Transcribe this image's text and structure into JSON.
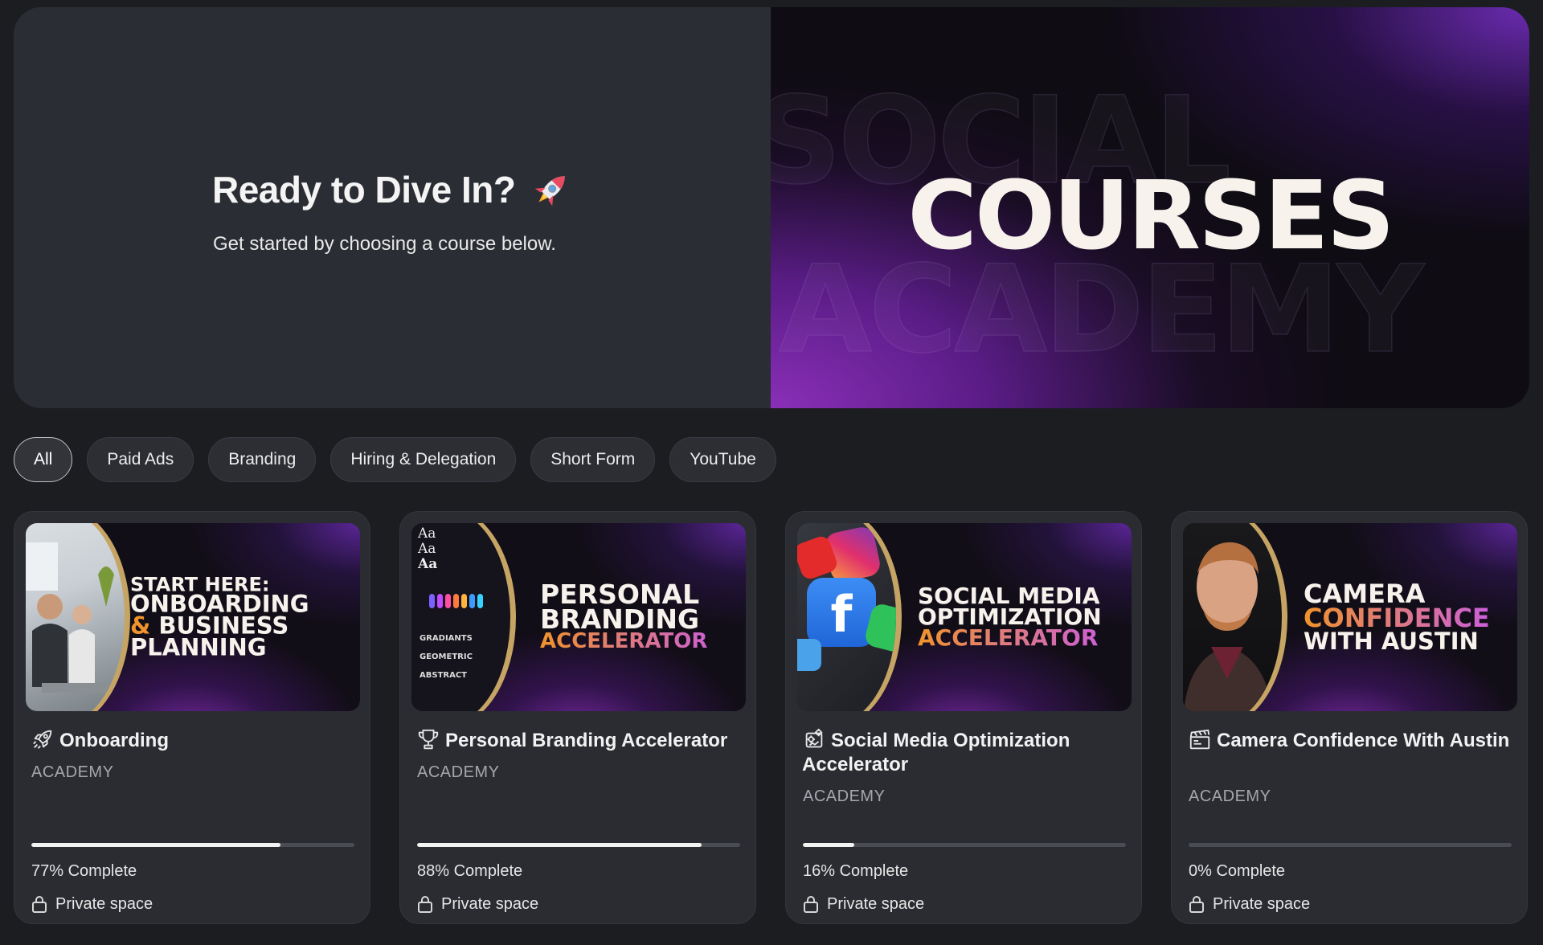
{
  "hero": {
    "heading": "Ready to Dive In?",
    "subheading": "Get started by choosing a course below.",
    "banner_title": "COURSES",
    "banner_ghost_1": "SOCIAL",
    "banner_ghost_2": "ACADEMY"
  },
  "filters": [
    {
      "label": "All",
      "active": true
    },
    {
      "label": "Paid Ads",
      "active": false
    },
    {
      "label": "Branding",
      "active": false
    },
    {
      "label": "Hiring & Delegation",
      "active": false
    },
    {
      "label": "Short Form",
      "active": false
    },
    {
      "label": "YouTube",
      "active": false
    }
  ],
  "courses": [
    {
      "thumb_lines": [
        "START HERE:",
        "ONBOARDING",
        "& BUSINESS",
        "PLANNING"
      ],
      "title": "Onboarding",
      "category": "ACADEMY",
      "progress": 77,
      "progress_label": "77% Complete",
      "visibility": "Private space",
      "icon": "rocket-outline-icon"
    },
    {
      "thumb_lines": [
        "PERSONAL",
        "BRANDING",
        "ACCELERATOR"
      ],
      "thumb_side": [
        "Aa",
        "Aa",
        "Aa",
        "GRADIANTS",
        "GEOMETRIC",
        "ABSTRACT"
      ],
      "title": "Personal Branding Accelerator",
      "category": "ACADEMY",
      "progress": 88,
      "progress_label": "88% Complete",
      "visibility": "Private space",
      "icon": "trophy-icon"
    },
    {
      "thumb_lines": [
        "SOCIAL MEDIA",
        "OPTIMIZATION",
        "ACCELERATOR"
      ],
      "title": "Social Media Optimization Accelerator",
      "category": "ACADEMY",
      "progress": 16,
      "progress_label": "16% Complete",
      "visibility": "Private space",
      "icon": "gear-analytics-icon"
    },
    {
      "thumb_lines": [
        "CAMERA",
        "CONFIDENCE",
        "WITH AUSTIN"
      ],
      "title": "Camera Confidence With Austin",
      "category": "ACADEMY",
      "progress": 0,
      "progress_label": "0% Complete",
      "visibility": "Private space",
      "icon": "clapperboard-icon"
    }
  ]
}
